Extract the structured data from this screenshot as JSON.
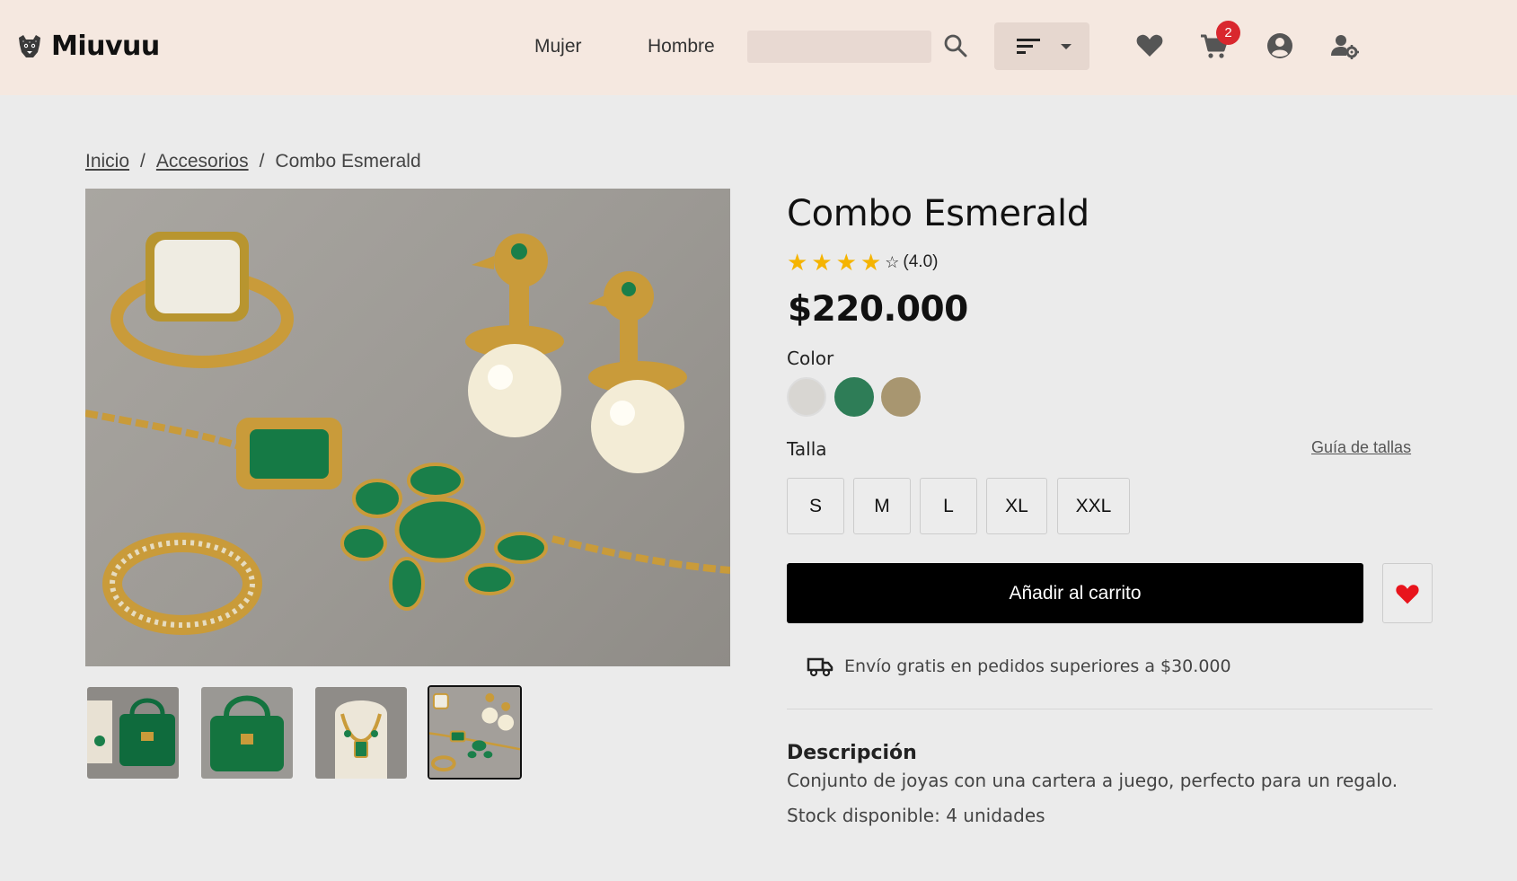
{
  "header": {
    "brand": "Miuvuu",
    "nav": [
      {
        "label": "Mujer"
      },
      {
        "label": "Hombre"
      }
    ],
    "search": {
      "placeholder": "",
      "value": ""
    },
    "cart_count": "2",
    "colors": {
      "background": "#f5e8e0",
      "badge": "#d9272e"
    }
  },
  "breadcrumb": {
    "items": [
      "Inicio",
      "Accesorios",
      "Combo Esmerald"
    ],
    "separator": "/"
  },
  "product": {
    "title": "Combo Esmerald",
    "rating": {
      "value": 4.0,
      "max": 5,
      "text": "(4.0)"
    },
    "price": "$220.000",
    "color_label": "Color",
    "colors": [
      "#d8d6d2",
      "#2e7d57",
      "#a89670"
    ],
    "size_label": "Talla",
    "size_guide": "Guía de tallas",
    "sizes": [
      "S",
      "M",
      "L",
      "XL",
      "XXL"
    ],
    "add_to_cart": "Añadir al carrito",
    "shipping": "Envío gratis en pedidos superiores a $30.000",
    "description_title": "Descripción",
    "description": "Conjunto de joyas con una cartera a juego, perfecto para un regalo.",
    "stock": "Stock disponible: 4 unidades"
  },
  "gallery": {
    "thumbnails": [
      "necklace-and-bag",
      "green-handbag",
      "emerald-necklace-bust",
      "jewelry-set"
    ],
    "active_index": 3
  }
}
